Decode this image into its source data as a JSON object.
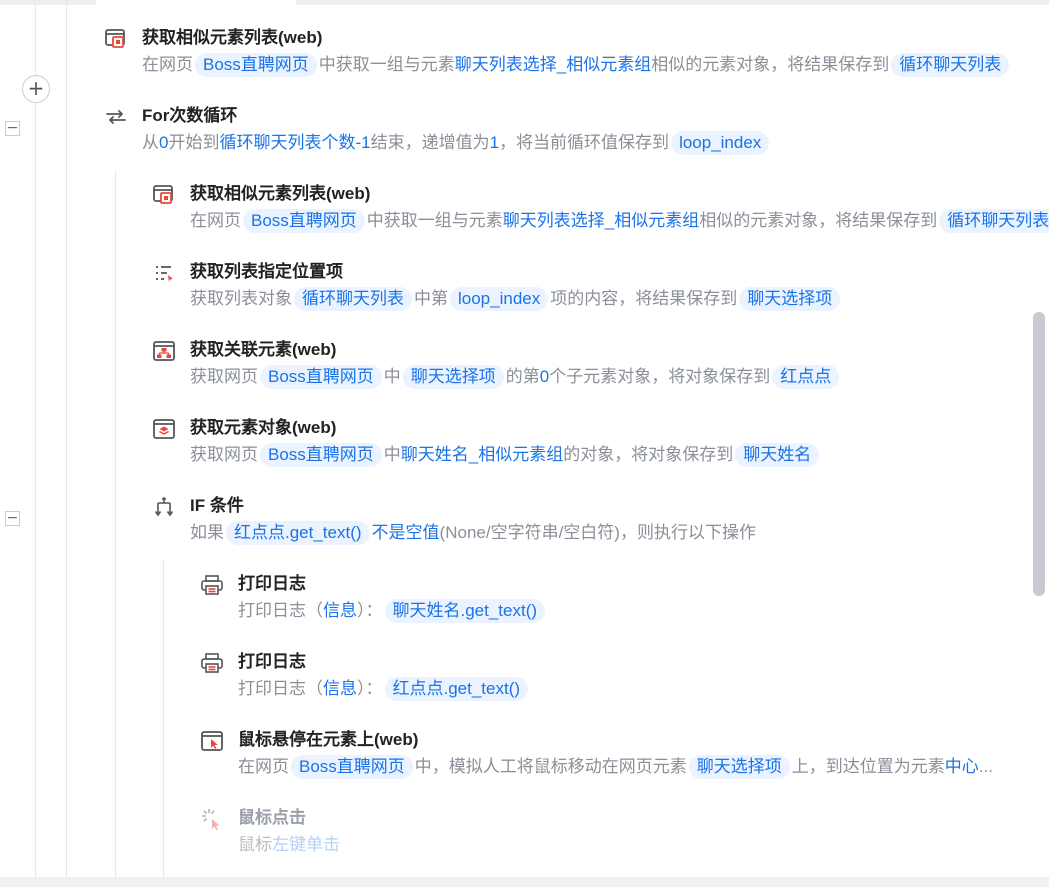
{
  "steps": {
    "s1": {
      "title": "获取相似元素列表(web)",
      "d1": "在网页",
      "c1": "Boss直聘网页",
      "d2": "中获取一组与元素",
      "h1": "聊天列表选择_相似元素组",
      "d3": "相似的元素对象，将结果保存到",
      "c2": "循环聊天列表"
    },
    "s2": {
      "title": "For次数循环",
      "d1": "从",
      "h1": "0",
      "d2": "开始到",
      "h2": "循环聊天列表个数-1",
      "d3": "结束，递增值为",
      "h3": "1",
      "d4": "，将当前循环值保存到",
      "c1": "loop_index"
    },
    "s3": {
      "title": "获取相似元素列表(web)",
      "d1": "在网页",
      "c1": "Boss直聘网页",
      "d2": "中获取一组与元素",
      "h1": "聊天列表选择_相似元素组",
      "d3": "相似的元素对象，将结果保存到",
      "c2": "循环聊天列表"
    },
    "s4": {
      "title": "获取列表指定位置项",
      "d1": "获取列表对象",
      "c1": "循环聊天列表",
      "d2": "中第",
      "c2": "loop_index",
      "d3": "项的内容，将结果保存到",
      "c3": "聊天选择项"
    },
    "s5": {
      "title": "获取关联元素(web)",
      "d1": "获取网页",
      "c1": "Boss直聘网页",
      "d2": "中",
      "c2": "聊天选择项",
      "d3": "的第",
      "h1": "0",
      "d4": "个子元素对象，将对象保存到",
      "c3": "红点点"
    },
    "s6": {
      "title": "获取元素对象(web)",
      "d1": "获取网页",
      "c1": "Boss直聘网页",
      "d2": "中",
      "h1": "聊天姓名_相似元素组",
      "d3": "的对象，将对象保存到",
      "c2": "聊天姓名"
    },
    "s7": {
      "title": "IF 条件",
      "d1": "如果",
      "c1": "红点点.get_text()",
      "h1": "不是空值",
      "d2": "(None/空字符串/空白符)，则执行以下操作"
    },
    "s8": {
      "title": "打印日志",
      "d1": "打印日志（",
      "h1": "信息",
      "d2": "）：",
      "c1": "聊天姓名.get_text()"
    },
    "s9": {
      "title": "打印日志",
      "d1": "打印日志（",
      "h1": "信息",
      "d2": "）：",
      "c1": "红点点.get_text()"
    },
    "s10": {
      "title": "鼠标悬停在元素上(web)",
      "d1": "在网页",
      "c1": "Boss直聘网页",
      "d2": "中，模拟人工将鼠标移动在网页元素",
      "c2": "聊天选择项",
      "d3": "上，到达位置为元素",
      "h1": "中心",
      "d4": "..."
    },
    "s11": {
      "title": "鼠标点击",
      "d1": "鼠标",
      "h1": "左键单击"
    }
  },
  "controls": {
    "add": "+",
    "collapse": "−"
  },
  "icons": {
    "s1": "similar-elements-icon",
    "s2": "loop-icon",
    "s3": "similar-elements-icon",
    "s4": "list-item-icon",
    "s5": "related-element-icon",
    "s6": "element-object-icon",
    "s7": "if-condition-icon",
    "s8": "printer-icon",
    "s9": "printer-icon",
    "s10": "mouse-hover-icon",
    "s11": "mouse-click-icon"
  },
  "colors": {
    "accent": "#1a73e8",
    "chip_bg": "#eaf3ff",
    "icon_red": "#e8473f",
    "title": "#222222",
    "desc": "#8a8f98"
  }
}
